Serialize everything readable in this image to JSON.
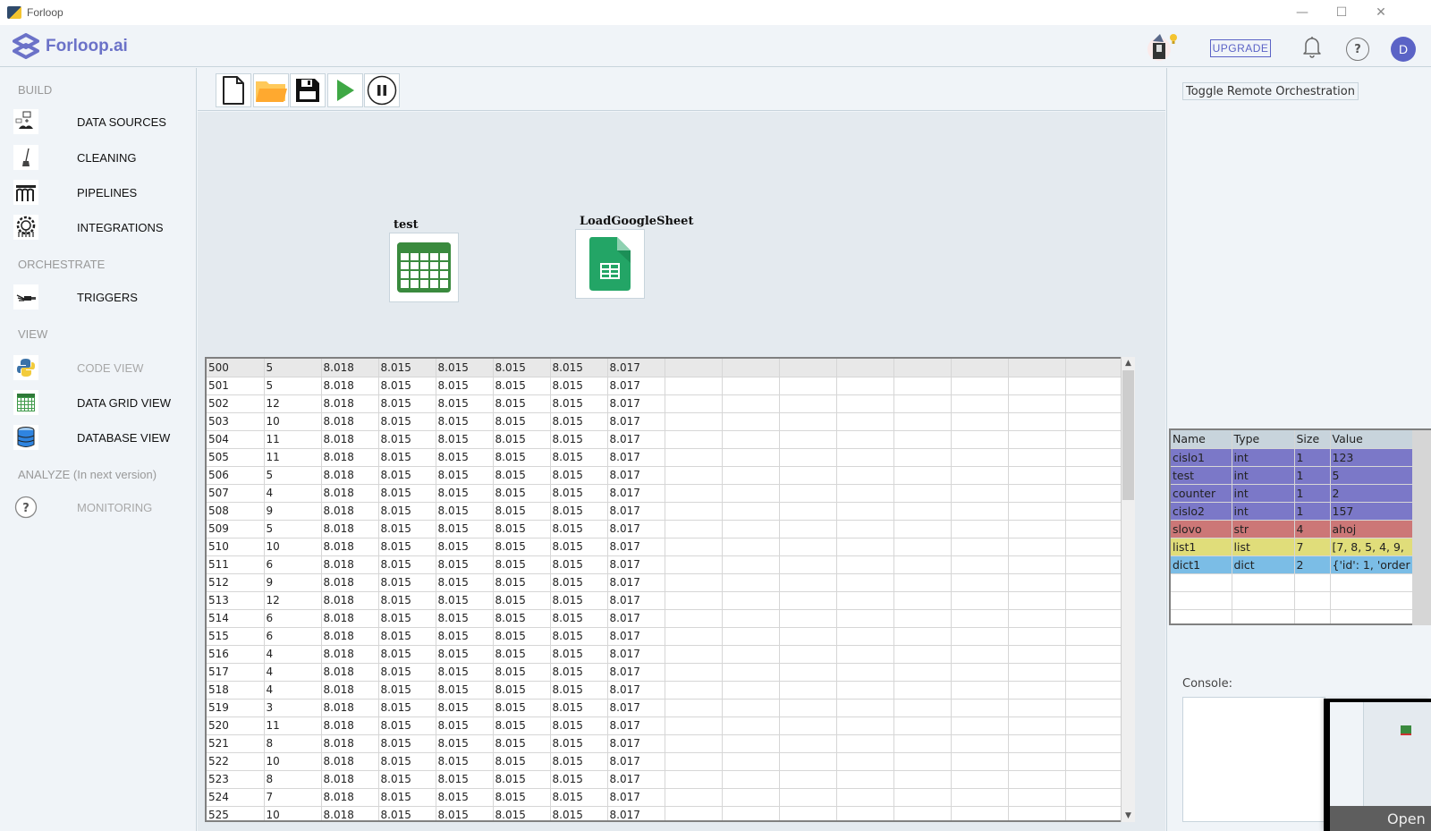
{
  "window": {
    "title": "Forloop",
    "controls": [
      "minimize",
      "maximize",
      "close"
    ]
  },
  "header": {
    "brand": "Forloop.ai",
    "upgrade_label": "UPGRADE",
    "avatar_initial": "D",
    "help_glyph": "?"
  },
  "sidebar": {
    "sections": [
      {
        "title": "BUILD",
        "items": [
          {
            "label": "DATA SOURCES",
            "icon": "api-hands-icon",
            "enabled": true
          },
          {
            "label": "CLEANING",
            "icon": "broom-icon",
            "enabled": true
          },
          {
            "label": "PIPELINES",
            "icon": "aqueduct-icon",
            "enabled": true
          },
          {
            "label": "INTEGRATIONS",
            "icon": "integration-gear-icon",
            "enabled": true
          }
        ]
      },
      {
        "title": "ORCHESTRATE",
        "items": [
          {
            "label": "TRIGGERS",
            "icon": "trigger-hand-icon",
            "enabled": true
          }
        ]
      },
      {
        "title": "VIEW",
        "items": [
          {
            "label": "CODE VIEW",
            "icon": "python-icon",
            "enabled": false
          },
          {
            "label": "DATA GRID VIEW",
            "icon": "grid-icon",
            "enabled": true
          },
          {
            "label": "DATABASE VIEW",
            "icon": "database-icon",
            "enabled": true
          }
        ]
      },
      {
        "title": "ANALYZE (In next version)",
        "items": [
          {
            "label": "MONITORING",
            "icon": "question-circle-icon",
            "enabled": false
          }
        ]
      }
    ]
  },
  "toolbar": {
    "buttons": [
      "new-file",
      "open-folder",
      "save",
      "run",
      "pause"
    ]
  },
  "canvas": {
    "nodes": [
      {
        "label": "test",
        "icon": "data-table-icon"
      },
      {
        "label": "LoadGoogleSheet",
        "icon": "google-sheets-icon"
      }
    ]
  },
  "grid": {
    "rows": [
      [
        "500",
        "5",
        "8.018",
        "8.015",
        "8.015",
        "8.015",
        "8.015",
        "8.017"
      ],
      [
        "501",
        "5",
        "8.018",
        "8.015",
        "8.015",
        "8.015",
        "8.015",
        "8.017"
      ],
      [
        "502",
        "12",
        "8.018",
        "8.015",
        "8.015",
        "8.015",
        "8.015",
        "8.017"
      ],
      [
        "503",
        "10",
        "8.018",
        "8.015",
        "8.015",
        "8.015",
        "8.015",
        "8.017"
      ],
      [
        "504",
        "11",
        "8.018",
        "8.015",
        "8.015",
        "8.015",
        "8.015",
        "8.017"
      ],
      [
        "505",
        "11",
        "8.018",
        "8.015",
        "8.015",
        "8.015",
        "8.015",
        "8.017"
      ],
      [
        "506",
        "5",
        "8.018",
        "8.015",
        "8.015",
        "8.015",
        "8.015",
        "8.017"
      ],
      [
        "507",
        "4",
        "8.018",
        "8.015",
        "8.015",
        "8.015",
        "8.015",
        "8.017"
      ],
      [
        "508",
        "9",
        "8.018",
        "8.015",
        "8.015",
        "8.015",
        "8.015",
        "8.017"
      ],
      [
        "509",
        "5",
        "8.018",
        "8.015",
        "8.015",
        "8.015",
        "8.015",
        "8.017"
      ],
      [
        "510",
        "10",
        "8.018",
        "8.015",
        "8.015",
        "8.015",
        "8.015",
        "8.017"
      ],
      [
        "511",
        "6",
        "8.018",
        "8.015",
        "8.015",
        "8.015",
        "8.015",
        "8.017"
      ],
      [
        "512",
        "9",
        "8.018",
        "8.015",
        "8.015",
        "8.015",
        "8.015",
        "8.017"
      ],
      [
        "513",
        "12",
        "8.018",
        "8.015",
        "8.015",
        "8.015",
        "8.015",
        "8.017"
      ],
      [
        "514",
        "6",
        "8.018",
        "8.015",
        "8.015",
        "8.015",
        "8.015",
        "8.017"
      ],
      [
        "515",
        "6",
        "8.018",
        "8.015",
        "8.015",
        "8.015",
        "8.015",
        "8.017"
      ],
      [
        "516",
        "4",
        "8.018",
        "8.015",
        "8.015",
        "8.015",
        "8.015",
        "8.017"
      ],
      [
        "517",
        "4",
        "8.018",
        "8.015",
        "8.015",
        "8.015",
        "8.015",
        "8.017"
      ],
      [
        "518",
        "4",
        "8.018",
        "8.015",
        "8.015",
        "8.015",
        "8.015",
        "8.017"
      ],
      [
        "519",
        "3",
        "8.018",
        "8.015",
        "8.015",
        "8.015",
        "8.015",
        "8.017"
      ],
      [
        "520",
        "11",
        "8.018",
        "8.015",
        "8.015",
        "8.015",
        "8.015",
        "8.017"
      ],
      [
        "521",
        "8",
        "8.018",
        "8.015",
        "8.015",
        "8.015",
        "8.015",
        "8.017"
      ],
      [
        "522",
        "10",
        "8.018",
        "8.015",
        "8.015",
        "8.015",
        "8.015",
        "8.017"
      ],
      [
        "523",
        "8",
        "8.018",
        "8.015",
        "8.015",
        "8.015",
        "8.015",
        "8.017"
      ],
      [
        "524",
        "7",
        "8.018",
        "8.015",
        "8.015",
        "8.015",
        "8.015",
        "8.017"
      ],
      [
        "525",
        "10",
        "8.018",
        "8.015",
        "8.015",
        "8.015",
        "8.015",
        "8.017"
      ]
    ],
    "empty_columns": 8
  },
  "right_panel": {
    "toggle_label": "Toggle Remote Orchestration",
    "variables": {
      "headers": [
        "Name",
        "Type",
        "Size",
        "Value"
      ],
      "rows": [
        {
          "name": "cislo1",
          "type": "int",
          "size": "1",
          "value": "123",
          "color": "#7b78c8"
        },
        {
          "name": "test",
          "type": "int",
          "size": "1",
          "value": "5",
          "color": "#7b78c8"
        },
        {
          "name": "counter",
          "type": "int",
          "size": "1",
          "value": "2",
          "color": "#7b78c8"
        },
        {
          "name": "cislo2",
          "type": "int",
          "size": "1",
          "value": "157",
          "color": "#7b78c8"
        },
        {
          "name": "slovo",
          "type": "str",
          "size": "4",
          "value": "ahoj",
          "color": "#cc7777"
        },
        {
          "name": "list1",
          "type": "list",
          "size": "7",
          "value": "[7, 8, 5, 4, 9,",
          "color": "#e0dd7a"
        },
        {
          "name": "dict1",
          "type": "dict",
          "size": "2",
          "value": "{'id': 1, 'order",
          "color": "#7bbde6"
        }
      ],
      "empty_rows": 3,
      "add_glyph": "+"
    },
    "console_label": "Console:",
    "preview_open_label": "Open"
  }
}
